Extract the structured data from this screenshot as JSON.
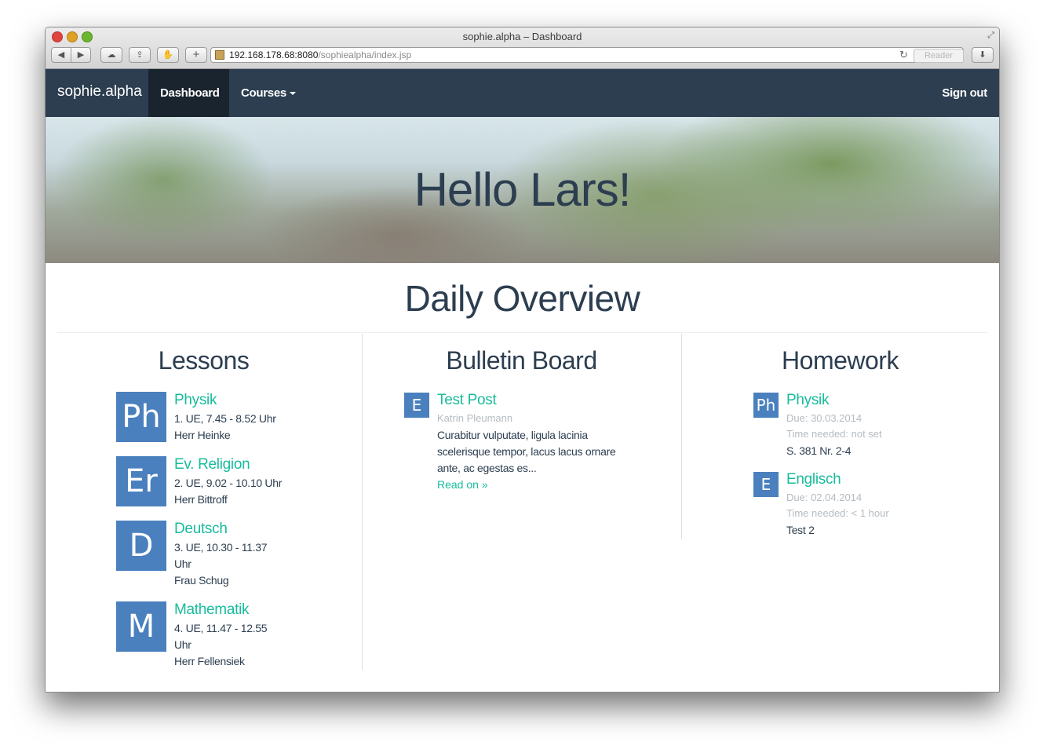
{
  "window": {
    "title": "sophie.alpha – Dashboard"
  },
  "browser": {
    "url_host": "192.168.178.68:8080",
    "url_path": "/sophiealpha/index.jsp",
    "reader_label": "Reader"
  },
  "navbar": {
    "brand": "sophie.alpha",
    "dashboard": "Dashboard",
    "courses": "Courses",
    "sign_out": "Sign out"
  },
  "hero": {
    "greeting": "Hello Lars!"
  },
  "overview": {
    "title": "Daily Overview"
  },
  "lessons": {
    "title": "Lessons",
    "items": [
      {
        "abbr": "Ph",
        "subject": "Physik",
        "time_lines": [
          "1. UE, 7.45 - 8.52 Uhr"
        ],
        "teacher": "Herr Heinke"
      },
      {
        "abbr": "Er",
        "subject": "Ev. Religion",
        "time_lines": [
          "2. UE, 9.02 - 10.10 Uhr"
        ],
        "teacher": "Herr Bittroff"
      },
      {
        "abbr": "D",
        "subject": "Deutsch",
        "time_lines": [
          "3. UE, 10.30 - 11.37",
          "Uhr"
        ],
        "teacher": "Frau Schug"
      },
      {
        "abbr": "M",
        "subject": "Mathematik",
        "time_lines": [
          "4. UE, 11.47 - 12.55",
          "Uhr"
        ],
        "teacher": "Herr Fellensiek"
      }
    ]
  },
  "bulletin": {
    "title": "Bulletin Board",
    "posts": [
      {
        "abbr": "E",
        "title": "Test Post",
        "author": "Katrin Pleumann",
        "body_lines": [
          "Curabitur vulputate, ligula lacinia",
          "scelerisque tempor, lacus lacus ornare",
          "ante, ac egestas es..."
        ],
        "read_on": "Read on »"
      }
    ]
  },
  "homework": {
    "title": "Homework",
    "items": [
      {
        "abbr": "Ph",
        "subject": "Physik",
        "due": "Due: 30.03.2014",
        "time_needed": "Time needed: not set",
        "task": "S. 381 Nr. 2-4"
      },
      {
        "abbr": "E",
        "subject": "Englisch",
        "due": "Due: 02.04.2014",
        "time_needed": "Time needed: < 1 hour",
        "task": "Test 2"
      }
    ]
  },
  "colors": {
    "navbar": "#2c3e50",
    "accent": "#18bc9c",
    "tile": "#4a80bd",
    "muted": "#b4bcc2"
  }
}
